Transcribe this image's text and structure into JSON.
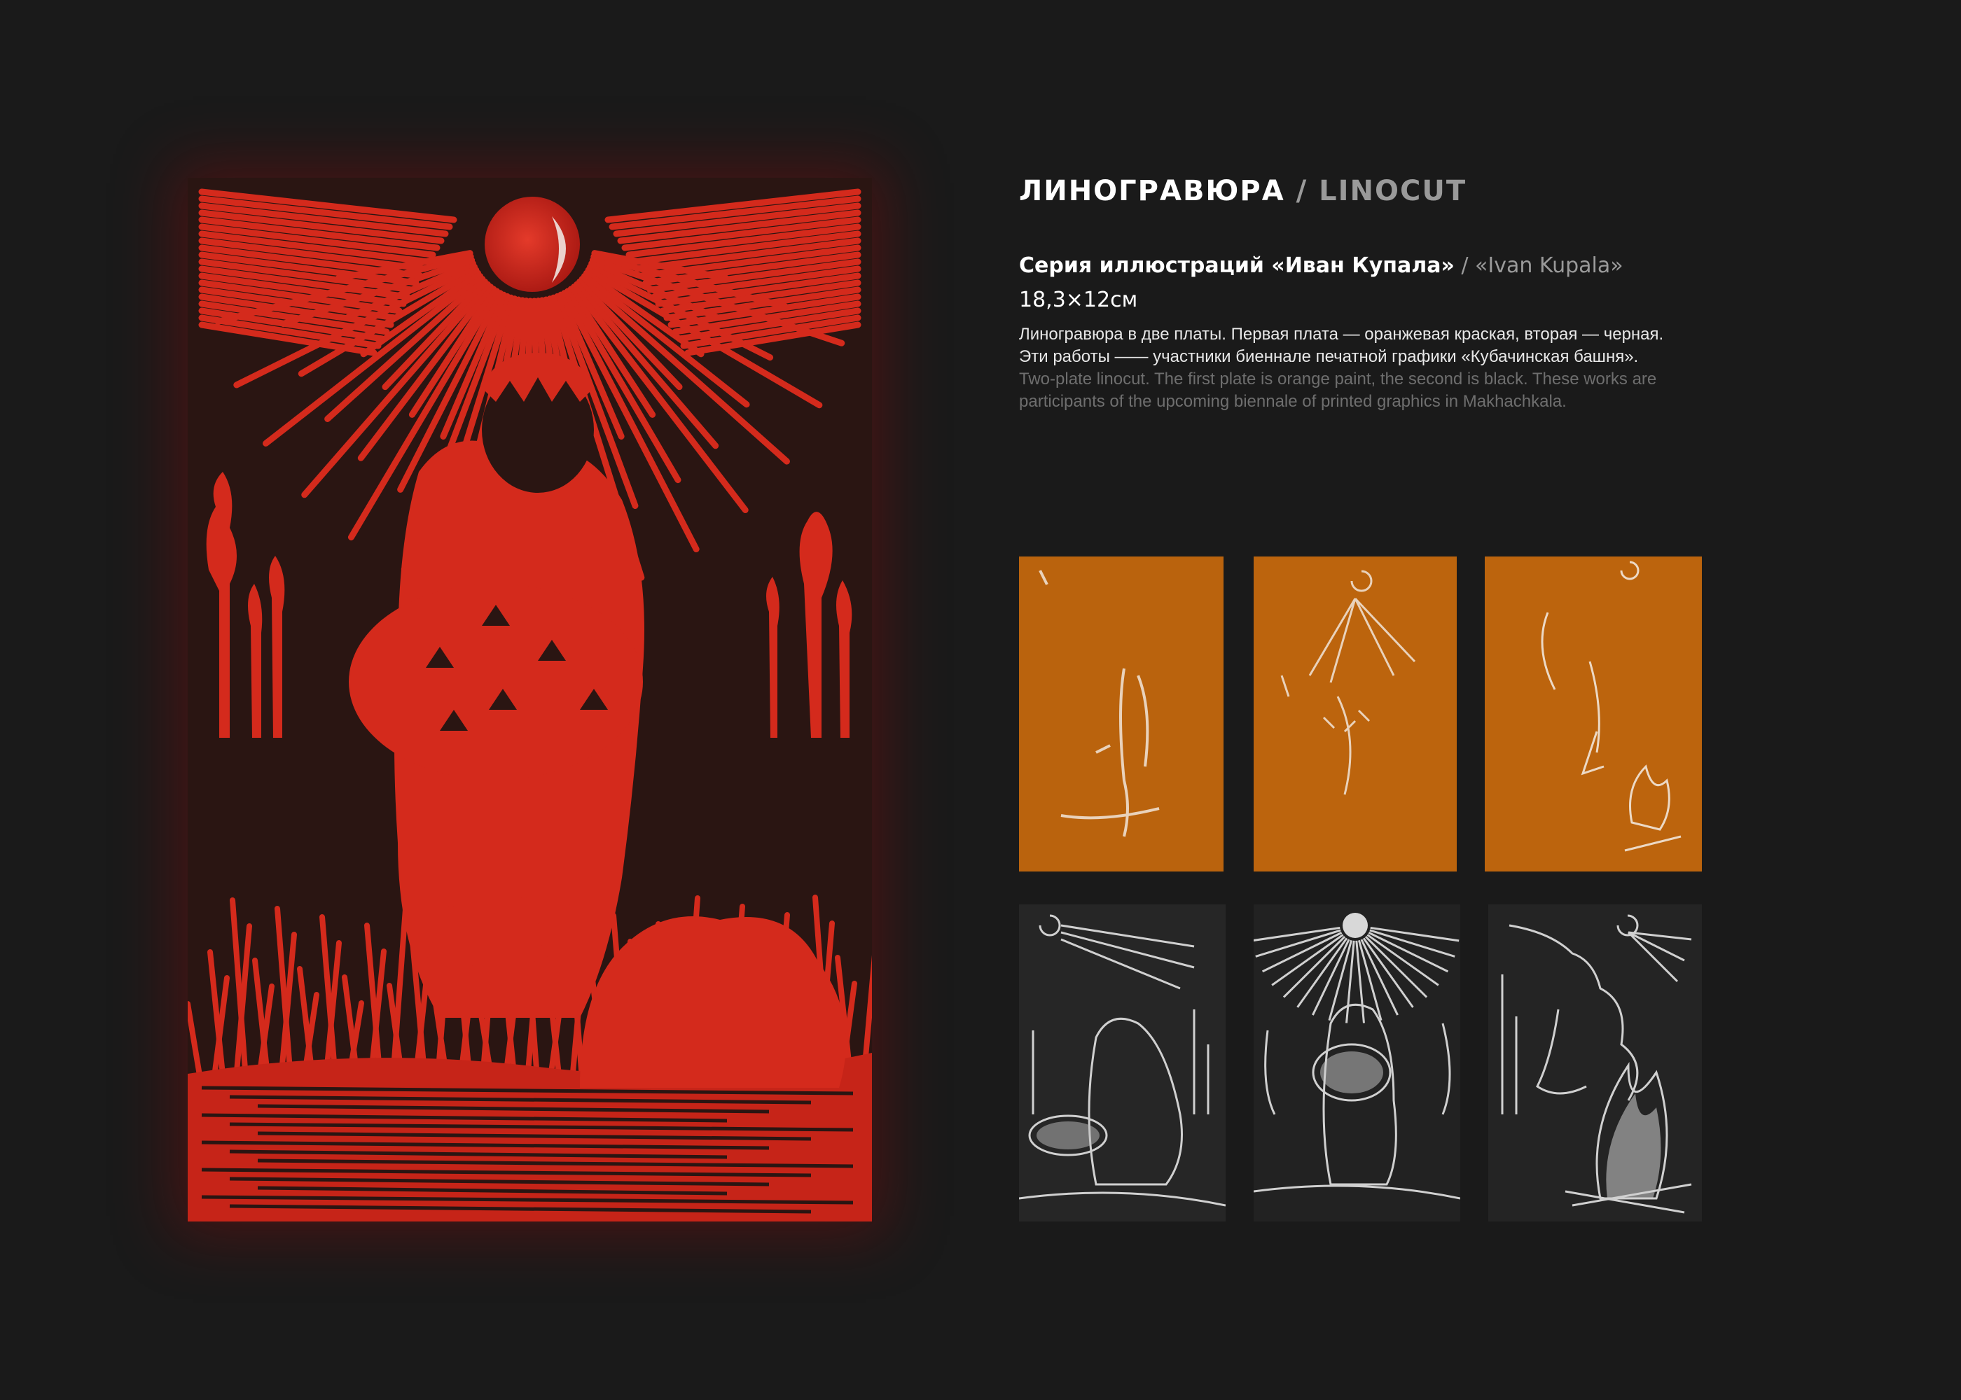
{
  "header": {
    "title_ru": "ЛИНОГРАВЮРА",
    "title_sep": " / ",
    "title_en": "LINOCUT"
  },
  "series": {
    "title_ru": "Серия иллюстраций «Иван Купала»",
    "sep": " / ",
    "title_en": "«Ivan Kupala»",
    "size": "18,3×12см"
  },
  "description": {
    "ru_line1": "Линогравюра в две платы. Первая плата — оранжевая краская, вторая — черная.",
    "ru_line2": "Эти работы —— участники биеннале печатной графики «Кубачинская башня».",
    "en_line1": " Two-plate linocut. The first plate is orange paint, the second is black. These works are",
    "en_line2": "participants of the upcoming biennale of printed graphics in Makhachkala."
  },
  "colors": {
    "background": "#1a1a1a",
    "print_red": "#d42a1c",
    "print_dark": "#2a1512",
    "plate_orange": "#c46a10",
    "plate_black": "#262626"
  },
  "images": {
    "main_print": "linocut-ivan-kupala-red",
    "orange_plates": [
      "orange-plate-1",
      "orange-plate-2",
      "orange-plate-3"
    ],
    "black_plates": [
      "black-plate-1",
      "black-plate-2",
      "black-plate-3"
    ]
  }
}
